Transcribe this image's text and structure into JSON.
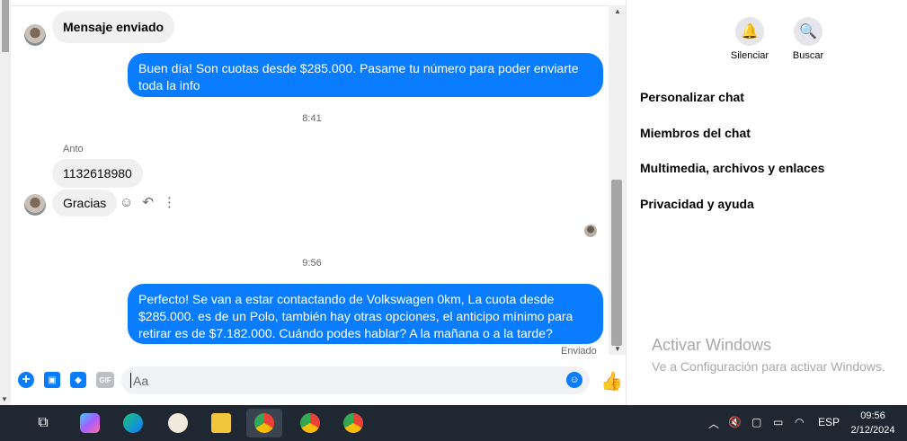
{
  "conversation": {
    "first_message": "Mensaje enviado",
    "outgoing_1": "Buen día! Son cuotas desde $285.000. Pasame tu número para poder enviarte toda la info",
    "time_1": "8:41",
    "sender_name": "Anto",
    "incoming_number": "1132618980",
    "incoming_thanks": "Gracias",
    "time_2": "9:56",
    "outgoing_2": "Perfecto!  Se van a estar contactando de Volkswagen 0km, La cuota desde $285.000. es de un Polo, también hay otras opciones, el anticipo mínimo para retirar es de $7.182.000. Cuándo podes hablar? A la mañana o a la tarde?",
    "status": "Enviado"
  },
  "composer": {
    "placeholder": "Aa",
    "gif_label": "GIF"
  },
  "side": {
    "mute_label": "Silenciar",
    "search_label": "Buscar",
    "items": [
      "Personalizar chat",
      "Miembros del chat",
      "Multimedia, archivos y enlaces",
      "Privacidad y ayuda"
    ]
  },
  "watermark": {
    "title": "Activar Windows",
    "subtitle": "Ve a Configuración para activar Windows."
  },
  "taskbar": {
    "lang": "ESP",
    "time": "09:56",
    "date": "2/12/2024"
  },
  "colors": {
    "accent": "#0a7cff",
    "bubble_in": "#f0f0f0",
    "taskbar": "#1f2732"
  },
  "icons": [
    "add-icon",
    "photo-icon",
    "sticker-icon",
    "gif-icon",
    "emoji-icon",
    "like-icon",
    "bell-icon",
    "search-icon",
    "react-icon",
    "reply-icon",
    "more-icon"
  ]
}
